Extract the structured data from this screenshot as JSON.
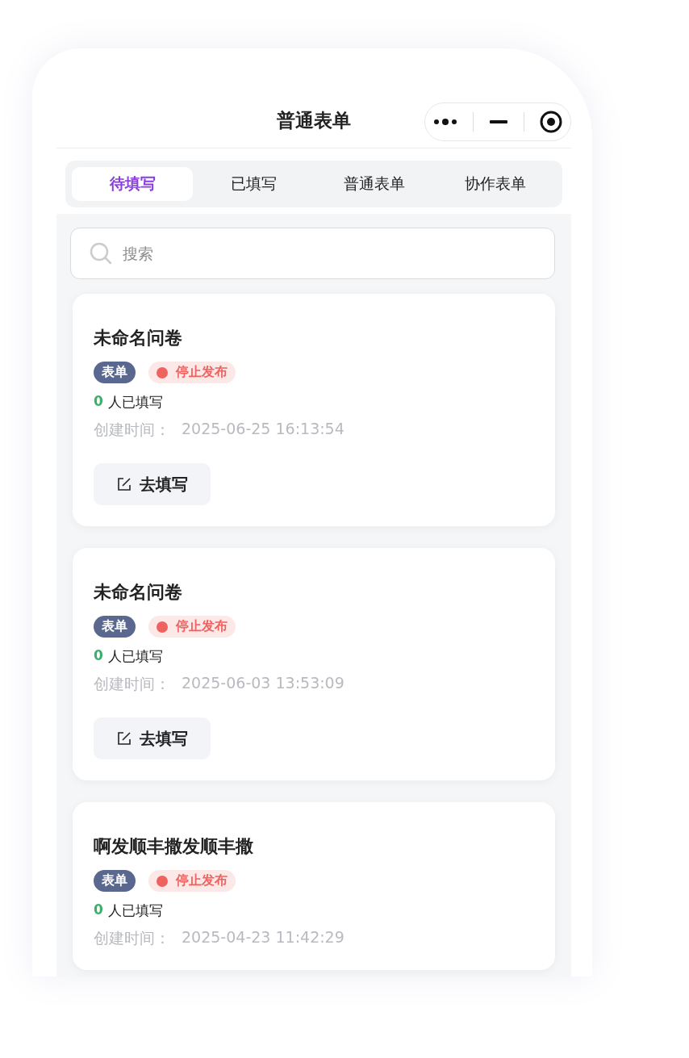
{
  "nav": {
    "title": "普通表单"
  },
  "tabs": [
    {
      "label": "待填写",
      "selected": true
    },
    {
      "label": "已填写",
      "selected": false
    },
    {
      "label": "普通表单",
      "selected": false
    },
    {
      "label": "协作表单",
      "selected": false
    }
  ],
  "search": {
    "placeholder": "搜索"
  },
  "forms": [
    {
      "title": "未命名问卷",
      "type_tag": "表单",
      "status": {
        "label": "停止发布",
        "color": "#ee6360"
      },
      "count": "0",
      "count_label": "人已填写",
      "created_label": "创建时间：",
      "created": "2025-06-25 16:13:54",
      "action": "去填写"
    },
    {
      "title": "未命名问卷",
      "type_tag": "表单",
      "status": {
        "label": "停止发布",
        "color": "#ee6360"
      },
      "count": "0",
      "count_label": "人已填写",
      "created_label": "创建时间：",
      "created": "2025-06-03 13:53:09",
      "action": "去填写"
    },
    {
      "title": "啊发顺丰撒发顺丰撒",
      "type_tag": "表单",
      "status": {
        "label": "停止发布",
        "color": "#ee6360"
      },
      "count": "0",
      "count_label": "人已填写",
      "created_label": "创建时间：",
      "created": "2025-04-23 11:42:29"
    }
  ]
}
